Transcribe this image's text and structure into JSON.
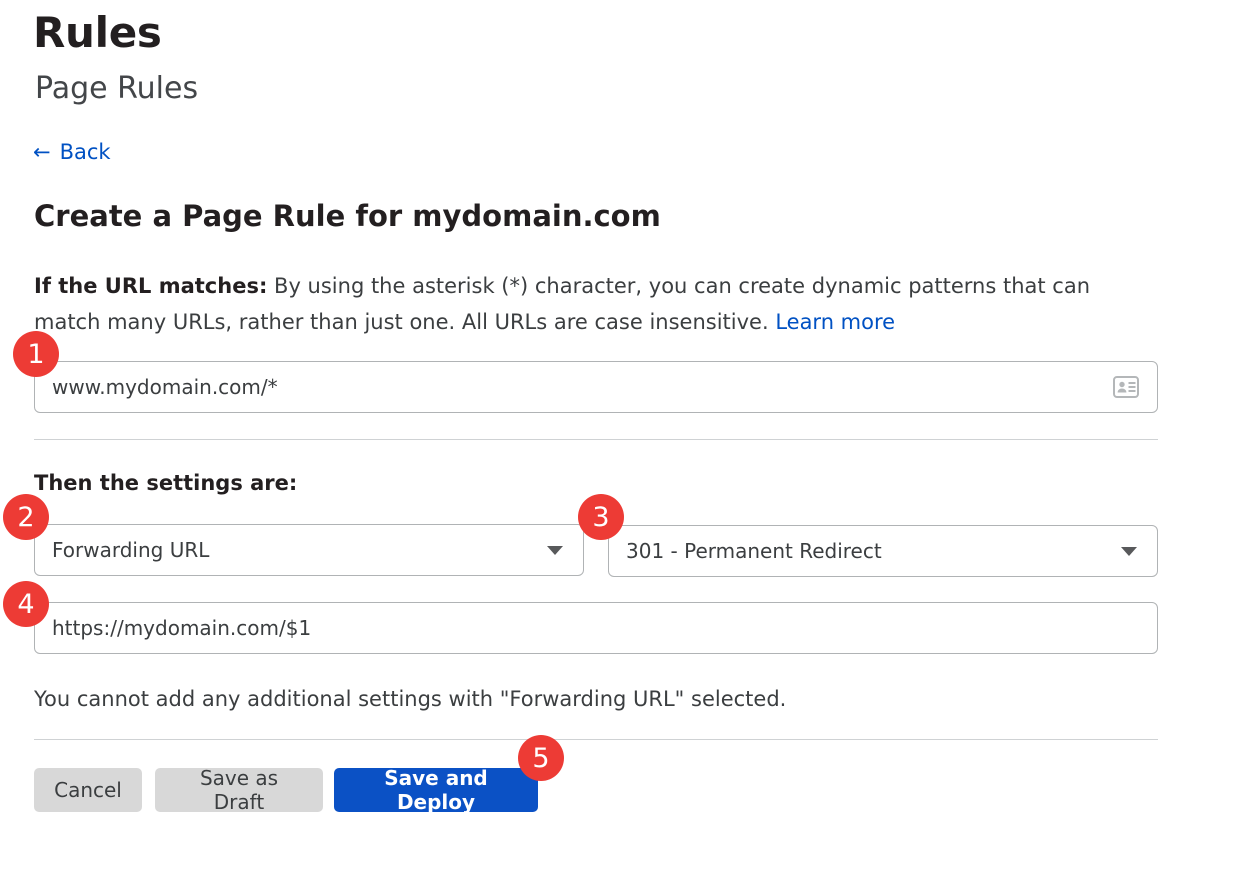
{
  "header": {
    "title": "Rules",
    "subtitle": "Page Rules",
    "back_label": "Back",
    "back_icon": "arrow-left-icon"
  },
  "form": {
    "title": "Create a Page Rule for mydomain.com",
    "match_label": "If the URL matches:",
    "match_description": " By using the asterisk (*) character, you can create dynamic patterns that can match many URLs, rather than just one. All URLs are case insensitive. ",
    "learn_more_label": "Learn more",
    "url_match_value": "www.mydomain.com/*",
    "url_match_icon": "contact-card-icon",
    "settings_label": "Then the settings are:",
    "action_value": "Forwarding URL",
    "status_value": "301 - Permanent Redirect",
    "destination_value": "https://mydomain.com/$1",
    "note": "You cannot add any additional settings with \"Forwarding URL\" selected."
  },
  "buttons": {
    "cancel": "Cancel",
    "save_draft": "Save as Draft",
    "save_deploy": "Save and Deploy"
  },
  "badges": {
    "one": "1",
    "two": "2",
    "three": "3",
    "four": "4",
    "five": "5"
  },
  "colors": {
    "badge_red": "#ed3b35",
    "primary_blue": "#0b51c5",
    "link_blue": "#0051c3",
    "secondary_gray": "#d8d8d8",
    "border_gray": "#b0b3b5",
    "divider_gray": "#cfd2d4"
  }
}
